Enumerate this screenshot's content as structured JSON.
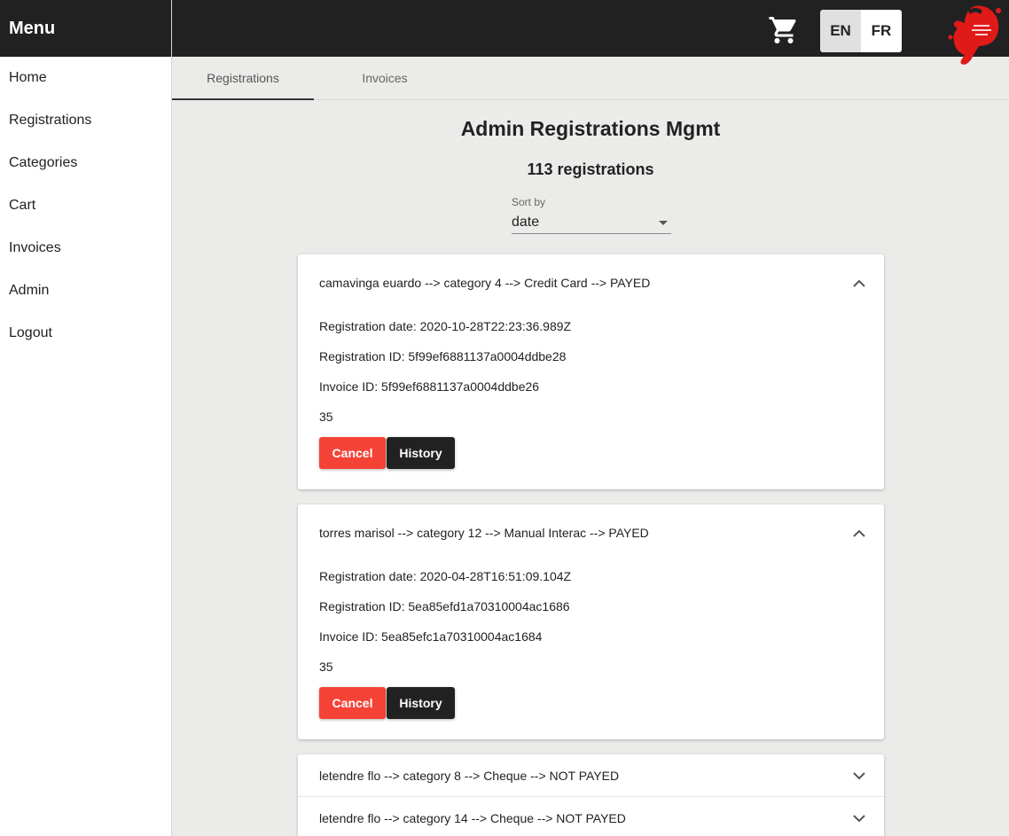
{
  "sidebar": {
    "title": "Menu",
    "items": [
      "Home",
      "Registrations",
      "Categories",
      "Cart",
      "Invoices",
      "Admin",
      "Logout"
    ]
  },
  "header": {
    "cart_icon": "shopping-cart-icon",
    "languages": [
      {
        "label": "EN",
        "active": true
      },
      {
        "label": "FR",
        "active": false
      }
    ],
    "logo_color": "#e01919"
  },
  "tabs": [
    {
      "label": "Registrations",
      "active": true
    },
    {
      "label": "Invoices",
      "active": false
    }
  ],
  "main": {
    "title": "Admin Registrations Mgmt",
    "count_text": "113 registrations",
    "sort": {
      "label": "Sort by",
      "value": "date"
    }
  },
  "registrations": [
    {
      "summary": "camavinga euardo --> category 4 --> Credit Card --> PAYED",
      "expanded": true,
      "registration_date": "Registration date: 2020-10-28T22:23:36.989Z",
      "registration_id": "Registration ID: 5f99ef6881137a0004ddbe28",
      "invoice_id": "Invoice ID: 5f99ef6881137a0004ddbe26",
      "amount": "35",
      "cancel_label": "Cancel",
      "history_label": "History"
    },
    {
      "summary": "torres marisol --> category 12 --> Manual Interac --> PAYED",
      "expanded": true,
      "registration_date": "Registration date: 2020-04-28T16:51:09.104Z",
      "registration_id": "Registration ID: 5ea85efd1a70310004ac1686",
      "invoice_id": "Invoice ID: 5ea85efc1a70310004ac1684",
      "amount": "35",
      "cancel_label": "Cancel",
      "history_label": "History"
    },
    {
      "summary": "letendre flo --> category 8 --> Cheque --> NOT PAYED",
      "expanded": false
    },
    {
      "summary": "letendre flo --> category 14 --> Cheque --> NOT PAYED",
      "expanded": false
    }
  ],
  "colors": {
    "topbar": "#212121",
    "cancel": "#f44336",
    "history": "#212121",
    "background": "#ebebe9"
  }
}
